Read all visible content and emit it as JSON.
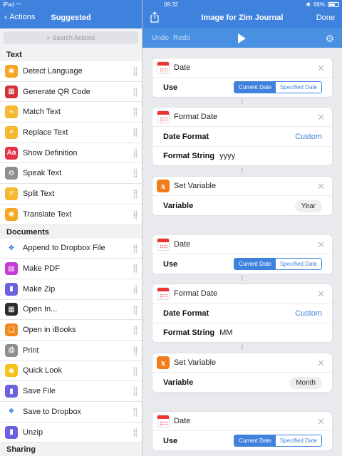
{
  "status": {
    "device": "iPad",
    "time": "09:32",
    "battery": "66%"
  },
  "left": {
    "back_label": "Actions",
    "title": "Suggested",
    "search_placeholder": "Search Actions",
    "sections": [
      {
        "title": "Text",
        "items": [
          {
            "label": "Detect Language",
            "icon": "globe-icon",
            "color": "#f5a623",
            "glyph": "◉"
          },
          {
            "label": "Generate QR Code",
            "icon": "qr-code-icon",
            "color": "#d0343a",
            "glyph": "▦"
          },
          {
            "label": "Match Text",
            "icon": "text-doc-icon",
            "color": "#f5b82e",
            "glyph": "≡"
          },
          {
            "label": "Replace Text",
            "icon": "text-doc-icon",
            "color": "#f5b82e",
            "glyph": "≡"
          },
          {
            "label": "Show Definition",
            "icon": "dictionary-icon",
            "color": "#e3344a",
            "glyph": "Aa"
          },
          {
            "label": "Speak Text",
            "icon": "settings-icon",
            "color": "#8e8e93",
            "glyph": "⚙"
          },
          {
            "label": "Split Text",
            "icon": "text-doc-icon",
            "color": "#f5b82e",
            "glyph": "≡"
          },
          {
            "label": "Translate Text",
            "icon": "globe-icon",
            "color": "#f5a623",
            "glyph": "◉"
          }
        ]
      },
      {
        "title": "Documents",
        "items": [
          {
            "label": "Append to Dropbox File",
            "icon": "dropbox-icon",
            "color": "#ffffff",
            "glyph": "❖"
          },
          {
            "label": "Make PDF",
            "icon": "pdf-icon",
            "color": "#c43bd6",
            "glyph": "▤"
          },
          {
            "label": "Make Zip",
            "icon": "file-icon",
            "color": "#6b62e0",
            "glyph": "▮"
          },
          {
            "label": "Open In...",
            "icon": "app-grid-icon",
            "color": "#2c2c2e",
            "glyph": "▦"
          },
          {
            "label": "Open in iBooks",
            "icon": "ibooks-icon",
            "color": "#f08a1f",
            "glyph": "❏"
          },
          {
            "label": "Print",
            "icon": "printer-icon",
            "color": "#8e8e93",
            "glyph": "⎙"
          },
          {
            "label": "Quick Look",
            "icon": "eye-icon",
            "color": "#f5c21b",
            "glyph": "◉"
          },
          {
            "label": "Save File",
            "icon": "file-icon",
            "color": "#6b62e0",
            "glyph": "▮"
          },
          {
            "label": "Save to Dropbox",
            "icon": "dropbox-icon",
            "color": "#ffffff",
            "glyph": "❖"
          },
          {
            "label": "Unzip",
            "icon": "file-icon",
            "color": "#6b62e0",
            "glyph": "▮"
          }
        ]
      },
      {
        "title": "Sharing",
        "items": []
      }
    ]
  },
  "right": {
    "title": "Image for Zim Journal",
    "done_label": "Done",
    "undo_label": "Undo",
    "redo_label": "Redo",
    "cards": {
      "date1": {
        "title": "Date",
        "use_label": "Use",
        "seg": [
          "Current Date",
          "Specified Date"
        ]
      },
      "fmt1": {
        "title": "Format Date",
        "date_format_label": "Date Format",
        "date_format_value": "Custom",
        "format_string_label": "Format String",
        "format_string_value": "yyyy"
      },
      "var1": {
        "title": "Set Variable",
        "variable_label": "Variable",
        "variable_value": "Year"
      },
      "date2": {
        "title": "Date",
        "use_label": "Use",
        "seg": [
          "Current Date",
          "Specified Date"
        ]
      },
      "fmt2": {
        "title": "Format Date",
        "date_format_label": "Date Format",
        "date_format_value": "Custom",
        "format_string_label": "Format String",
        "format_string_value": "MM"
      },
      "var2": {
        "title": "Set Variable",
        "variable_label": "Variable",
        "variable_value": "Month"
      },
      "date3": {
        "title": "Date",
        "use_label": "Use",
        "seg": [
          "Current Date",
          "Specified Date"
        ]
      }
    }
  },
  "colors": {
    "accent": "#3f82de",
    "variable": "#f07c1a",
    "calendar": "#e33333"
  }
}
